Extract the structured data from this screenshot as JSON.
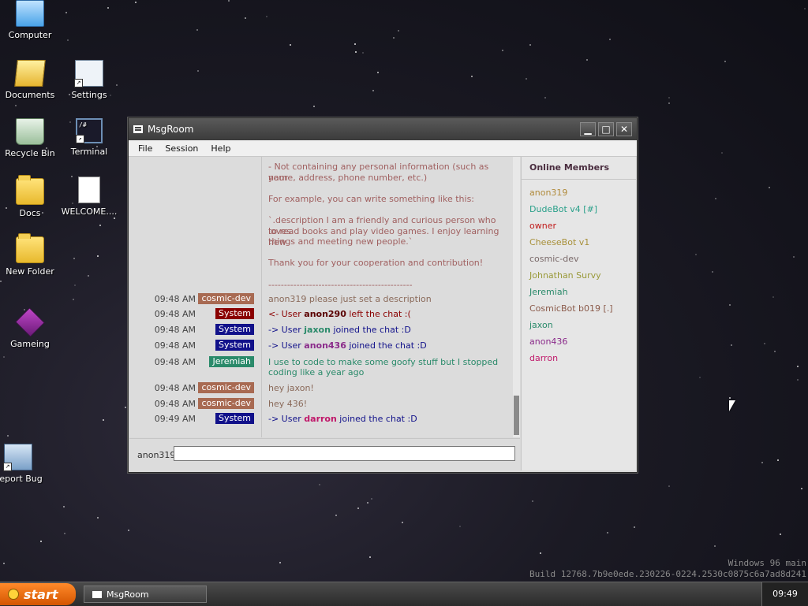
{
  "desktop_icons": [
    {
      "label": "Computer",
      "icon": "computer-icon"
    },
    {
      "label": "Documents",
      "icon": "documents-icon"
    },
    {
      "label": "Settings",
      "icon": "settings-icon"
    },
    {
      "label": "Recycle Bin",
      "icon": "recycle-bin-icon"
    },
    {
      "label": "Terminal",
      "icon": "terminal-icon"
    },
    {
      "label": "Docs",
      "icon": "folder-icon"
    },
    {
      "label": "WELCOME....",
      "icon": "markdown-file-icon"
    },
    {
      "label": "New Folder",
      "icon": "folder-icon"
    },
    {
      "label": "Gameing",
      "icon": "cube-icon"
    },
    {
      "label": "Report Bug",
      "icon": "report-bug-icon"
    }
  ],
  "window": {
    "title": "MsgRoom",
    "controls": {
      "minimize": "▁",
      "maximize": "□",
      "close": "✕"
    },
    "menu": [
      "File",
      "Session",
      "Help"
    ]
  },
  "rules_text": [
    "- Not containing any personal information (such as your",
    "name, address, phone number, etc.)",
    "",
    "For example, you can write something like this:",
    "",
    "`.description I am a friendly and curious person who loves",
    "to read books and play video games. I enjoy learning new",
    "things and meeting new people.`",
    "",
    "Thank you for your cooperation and contribution!",
    "",
    "----------------------------------------------"
  ],
  "messages": [
    {
      "time": "09:48 AM",
      "user": "cosmic-dev",
      "user_bg": "#a86a52",
      "text": "anon319 please just set a description",
      "text_color": "#8a6a5a"
    },
    {
      "time": "09:48 AM",
      "user": "System",
      "user_bg": "#8a0000",
      "pre": "<- User ",
      "bold": "anon290",
      "bold_color": "#5a0000",
      "post": " left the chat :(",
      "text_color": "#8a0000"
    },
    {
      "time": "09:48 AM",
      "user": "System",
      "user_bg": "#11118a",
      "pre": "-> User ",
      "bold": "jaxon",
      "bold_color": "#2a8a6a",
      "post": " joined the chat :D",
      "text_color": "#11118a"
    },
    {
      "time": "09:48 AM",
      "user": "System",
      "user_bg": "#11118a",
      "pre": "-> User ",
      "bold": "anon436",
      "bold_color": "#8a2a8a",
      "post": " joined the chat :D",
      "text_color": "#11118a"
    },
    {
      "time": "09:48 AM",
      "user": "Jeremiah",
      "user_bg": "#2a8a6a",
      "text": "I use to code to make some goofy stuff but I stopped",
      "text2": "coding like a year ago",
      "text_color": "#2a8a6a"
    },
    {
      "time": "09:48 AM",
      "user": "cosmic-dev",
      "user_bg": "#a86a52",
      "text": "hey jaxon!",
      "text_color": "#8a6a5a"
    },
    {
      "time": "09:48 AM",
      "user": "cosmic-dev",
      "user_bg": "#a86a52",
      "text": "hey 436!",
      "text_color": "#8a6a5a"
    },
    {
      "time": "09:49 AM",
      "user": "System",
      "user_bg": "#11118a",
      "pre": "-> User ",
      "bold": "darron",
      "bold_color": "#c0186a",
      "post": " joined the chat :D",
      "text_color": "#11118a"
    }
  ],
  "members": {
    "header": "Online Members",
    "list": [
      {
        "name": "anon319",
        "color": "#b08a3a"
      },
      {
        "name": "DudeBot v4 [#]",
        "color": "#2aa08a"
      },
      {
        "name": "owner",
        "color": "#c01a1a"
      },
      {
        "name": "CheeseBot v1",
        "color": "#a8903a"
      },
      {
        "name": "cosmic-dev",
        "color": "#7a6a6a"
      },
      {
        "name": "Johnathan Survy",
        "color": "#9a9a3a"
      },
      {
        "name": "Jeremiah",
        "color": "#2a8a6a"
      },
      {
        "name": "CosmicBot b019 [.]",
        "color": "#8a5a4a"
      },
      {
        "name": "jaxon",
        "color": "#2a8a6a"
      },
      {
        "name": "anon436",
        "color": "#8a2a8a"
      },
      {
        "name": "darron",
        "color": "#c0186a"
      }
    ]
  },
  "input": {
    "nick": "anon319",
    "value": ""
  },
  "taskbar": {
    "start_label": "start",
    "item_label": "MsgRoom",
    "clock": "09:49"
  },
  "watermark": {
    "line1": "Windows 96 main",
    "line2": "Build 12768.7b9e0ede.230226-0224.2530c0875c6a7ad8d241"
  }
}
